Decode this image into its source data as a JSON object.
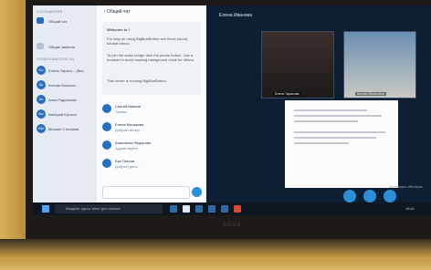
{
  "users_panel": {
    "heading_messages": "СООБЩЕНИЯ",
    "public_chat": "Общий чат",
    "shared_notes": "Общие заметки",
    "heading_users": "ПОЛЬЗОВАТЕЛИ (6)",
    "users": [
      {
        "initials": "Ел",
        "name": "Елена Тарасо... (Вы)"
      },
      {
        "initials": "Кр",
        "name": "Ксения Малыхи..."
      },
      {
        "initials": "Ан",
        "name": "Анна Родионова"
      },
      {
        "initials": "Ва",
        "name": "Валерий Ерохин"
      },
      {
        "initials": "Ми",
        "name": "Михаил Степанов"
      }
    ]
  },
  "chat": {
    "title": "‹ Общий чат",
    "welcome": [
      "Welcome to !",
      "For help on using BigBlueButton see these (short) tutorial videos.",
      "To join the audio bridge click the phone button. Use a headset to avoid causing background noise for others.",
      "This server is running BigBlueButton."
    ],
    "messages": [
      {
        "name": "Сергей Иванов",
        "text": "Привет"
      },
      {
        "name": "Елена Малькова",
        "text": "Добрый вечер"
      },
      {
        "name": "Анастасия Федорова",
        "text": "Здравствуйте"
      },
      {
        "name": "Баз Петров",
        "text": "Добрый день"
      }
    ],
    "input_placeholder": ""
  },
  "stage": {
    "meeting_title": "Елена Иванова",
    "video1_label": "Елена Тарасова",
    "video2_label": "Ксения Малыхина",
    "windows_overlay": "Активация Windows"
  },
  "taskbar": {
    "search_placeholder": "Введите здесь текст для поиска",
    "clock": "18:41"
  },
  "brand": "ASUS"
}
